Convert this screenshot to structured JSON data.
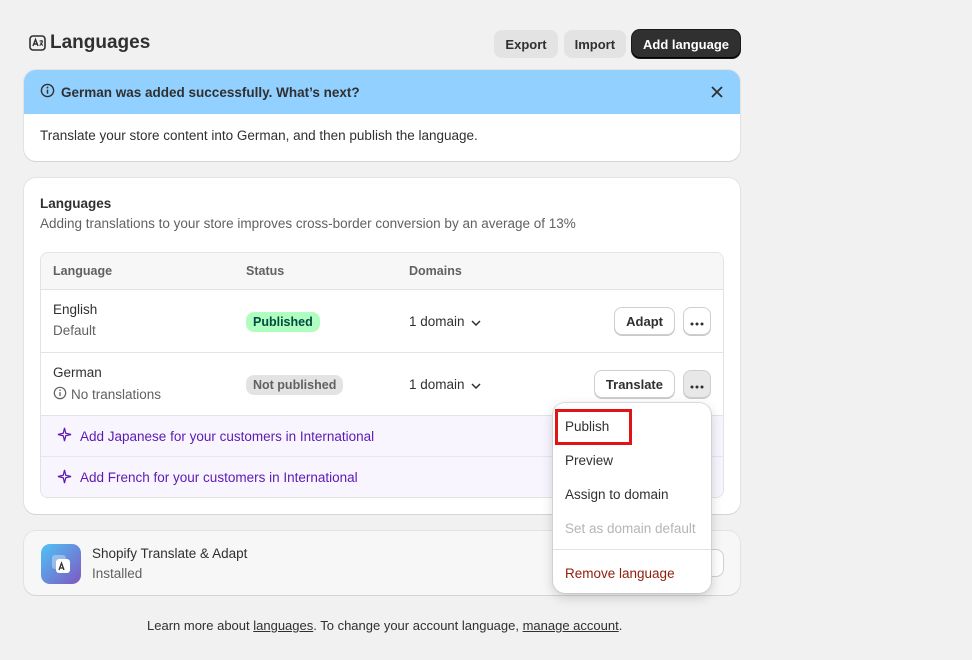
{
  "header": {
    "title": "Languages",
    "export_label": "Export",
    "import_label": "Import",
    "add_label": "Add language"
  },
  "banner": {
    "title": "German was added successfully. What’s next?",
    "body": "Translate your store content into German, and then publish the language."
  },
  "section": {
    "title": "Languages",
    "subtitle": "Adding translations to your store improves cross-border conversion by an average of 13%"
  },
  "table": {
    "headers": [
      "Language",
      "Status",
      "Domains"
    ],
    "rows": [
      {
        "language": "English",
        "sub": "Default",
        "status": "Published",
        "domains": "1 domain",
        "action": "Adapt"
      },
      {
        "language": "German",
        "sub": "No translations",
        "status": "Not published",
        "domains": "1 domain",
        "action": "Translate"
      }
    ],
    "suggestions": [
      "Add Japanese for your customers in International",
      "Add French for your customers in International"
    ]
  },
  "app": {
    "name": "Shopify Translate & Adapt",
    "status": "Installed"
  },
  "footer": {
    "prefix": "Learn more about ",
    "link1": "languages",
    "middle": ". To change your account language, ",
    "link2": "manage account",
    "suffix": "."
  },
  "menu": {
    "items": [
      "Publish",
      "Preview",
      "Assign to domain",
      "Set as domain default",
      "Remove language"
    ]
  },
  "colors": {
    "banner": "#91d0ff",
    "published_badge": "#affebf",
    "suggest": "#5c1ab3",
    "critical": "#8e1f0b",
    "highlight": "#e01414"
  }
}
